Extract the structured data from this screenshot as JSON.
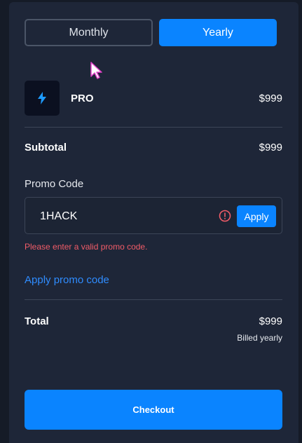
{
  "billing_toggle": {
    "monthly_label": "Monthly",
    "yearly_label": "Yearly",
    "selected": "Yearly"
  },
  "product": {
    "icon": "lightning-bolt-icon",
    "name": "PRO",
    "price": "$999"
  },
  "subtotal": {
    "label": "Subtotal",
    "value": "$999"
  },
  "promo": {
    "label": "Promo Code",
    "value": "1HACK",
    "apply_label": "Apply",
    "error": "Please enter a valid promo code.",
    "apply_link": "Apply promo code"
  },
  "total": {
    "label": "Total",
    "value": "$999",
    "billing_note": "Billed yearly"
  },
  "checkout_label": "Checkout",
  "colors": {
    "accent": "#0a84ff",
    "error": "#f25c68",
    "background": "#1e2638",
    "link": "#2f8cff"
  }
}
